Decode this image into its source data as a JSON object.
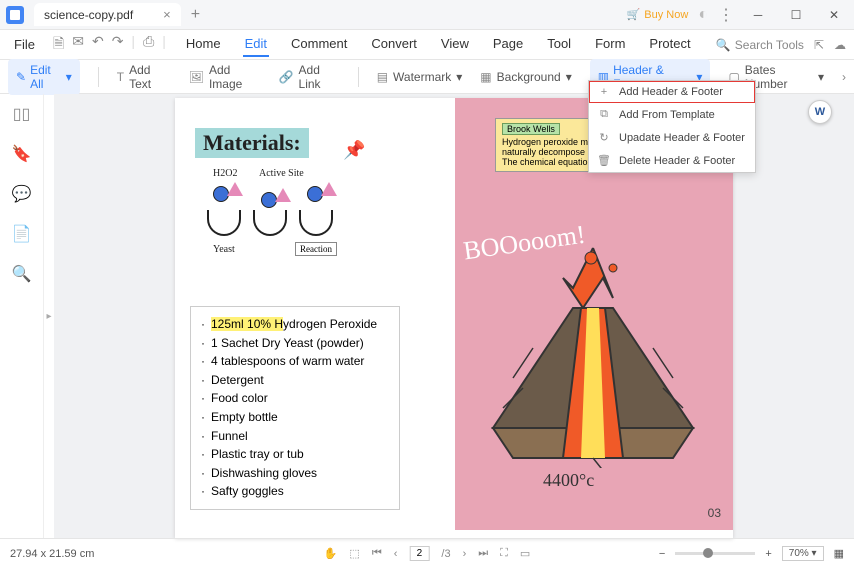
{
  "titlebar": {
    "filename": "science-copy.pdf",
    "buy_now": "Buy Now"
  },
  "menubar": {
    "file": "File",
    "items": [
      "Home",
      "Edit",
      "Comment",
      "Convert",
      "View",
      "Page",
      "Tool",
      "Form",
      "Protect"
    ],
    "search_placeholder": "Search Tools"
  },
  "toolbar": {
    "edit_all": "Edit All",
    "add_text": "Add Text",
    "add_image": "Add Image",
    "add_link": "Add Link",
    "watermark": "Watermark",
    "background": "Background",
    "header_footer": "Header & Footer",
    "bates_number": "Bates Number"
  },
  "dropdown": {
    "items": [
      {
        "icon": "+",
        "label": "Add Header & Footer"
      },
      {
        "icon": "⧉",
        "label": "Add From Template"
      },
      {
        "icon": "↻",
        "label": "Upadate Header & Footer"
      },
      {
        "icon": "🗑",
        "label": "Delete Header & Footer"
      }
    ]
  },
  "page1": {
    "title": "Materials:",
    "diagram": {
      "h2o2": "H2O2",
      "active_site": "Active Site",
      "yeast": "Yeast",
      "reaction": "Reaction"
    },
    "list": [
      {
        "text": "125ml 10% Hydrogen Peroxide",
        "highlight_end": 11
      },
      {
        "text": "1 Sachet Dry Yeast (powder)"
      },
      {
        "text": "4 tablespoons of warm water"
      },
      {
        "text": "Detergent"
      },
      {
        "text": "Food color"
      },
      {
        "text": "Empty bottle"
      },
      {
        "text": "Funnel"
      },
      {
        "text": "Plastic tray or tub"
      },
      {
        "text": "Dishwashing gloves"
      },
      {
        "text": "Safty goggles"
      }
    ]
  },
  "page2": {
    "note_author": "Brook Wells",
    "note_l1": "Hydrogen peroxide molecules are unstable and will",
    "note_l2": "naturally decompose into water and oxygen over time.",
    "note_l3": "The chemical equation for this decomposition is:",
    "boom": "BOOooom!",
    "temp": "4400°c",
    "page_num": "03"
  },
  "statusbar": {
    "dimensions": "27.94 x 21.59 cm",
    "page_current": "2",
    "page_total": "/3",
    "zoom": "70%"
  }
}
